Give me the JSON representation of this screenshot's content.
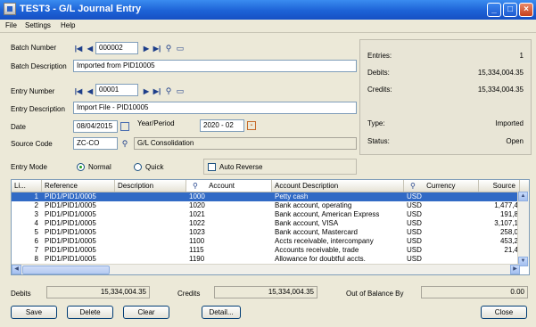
{
  "window": {
    "title": "TEST3 - G/L Journal Entry"
  },
  "menu": [
    "File",
    "Settings",
    "Help"
  ],
  "batch": {
    "number_label": "Batch Number",
    "number": "000002",
    "desc_label": "Batch Description",
    "description": "Imported from PID10005"
  },
  "entry": {
    "number_label": "Entry Number",
    "number": "00001",
    "desc_label": "Entry Description",
    "description": "Import File - PID10005",
    "date_label": "Date",
    "date": "08/04/2015",
    "yp_label": "Year/Period",
    "year_period": "2020 - 02",
    "source_label": "Source Code",
    "source_code": "ZC-CO",
    "source_desc": "G/L Consolidation",
    "mode_label": "Entry Mode",
    "mode_normal": "Normal",
    "mode_quick": "Quick",
    "auto_reverse": "Auto Reverse"
  },
  "summary": {
    "entries_label": "Entries:",
    "entries": "1",
    "debits_label": "Debits:",
    "debits": "15,334,004.35",
    "credits_label": "Credits:",
    "credits": "15,334,004.35",
    "type_label": "Type:",
    "type": "Imported",
    "status_label": "Status:",
    "status": "Open"
  },
  "grid": {
    "headers": [
      "Li...",
      "Reference",
      "Description",
      "Account",
      "Account Description",
      "Currency",
      "Source"
    ],
    "rows": [
      {
        "line": "1",
        "ref": "PID1/PID1/0005",
        "desc": "",
        "acct": "1000",
        "acct_desc": "Petty cash",
        "cur": "USD",
        "src": ""
      },
      {
        "line": "2",
        "ref": "PID1/PID1/0005",
        "desc": "",
        "acct": "1020",
        "acct_desc": "Bank account, operating",
        "cur": "USD",
        "src": "1,477,4"
      },
      {
        "line": "3",
        "ref": "PID1/PID1/0005",
        "desc": "",
        "acct": "1021",
        "acct_desc": "Bank account, American Express",
        "cur": "USD",
        "src": "191,8"
      },
      {
        "line": "4",
        "ref": "PID1/PID1/0005",
        "desc": "",
        "acct": "1022",
        "acct_desc": "Bank account, VISA",
        "cur": "USD",
        "src": "3,107,1"
      },
      {
        "line": "5",
        "ref": "PID1/PID1/0005",
        "desc": "",
        "acct": "1023",
        "acct_desc": "Bank account, Mastercard",
        "cur": "USD",
        "src": "258,0"
      },
      {
        "line": "6",
        "ref": "PID1/PID1/0005",
        "desc": "",
        "acct": "1100",
        "acct_desc": "Accts receivable, intercompany",
        "cur": "USD",
        "src": "453,2"
      },
      {
        "line": "7",
        "ref": "PID1/PID1/0005",
        "desc": "",
        "acct": "1115",
        "acct_desc": "Accounts receivable, trade",
        "cur": "USD",
        "src": "21,4"
      },
      {
        "line": "8",
        "ref": "PID1/PID1/0005",
        "desc": "",
        "acct": "1190",
        "acct_desc": "Allowance for doubtful accts.",
        "cur": "USD",
        "src": ""
      }
    ]
  },
  "totals": {
    "debits_label": "Debits",
    "debits": "15,334,004.35",
    "credits_label": "Credits",
    "credits": "15,334,004.35",
    "oob_label": "Out of Balance By",
    "oob": "0.00"
  },
  "buttons": {
    "save": "Save",
    "delete": "Delete",
    "clear": "Clear",
    "detail": "Detail...",
    "close": "Close"
  },
  "colors": {
    "title_bar": "#1d62d6",
    "selection": "#316ac5",
    "window_bg": "#ece9d8"
  }
}
